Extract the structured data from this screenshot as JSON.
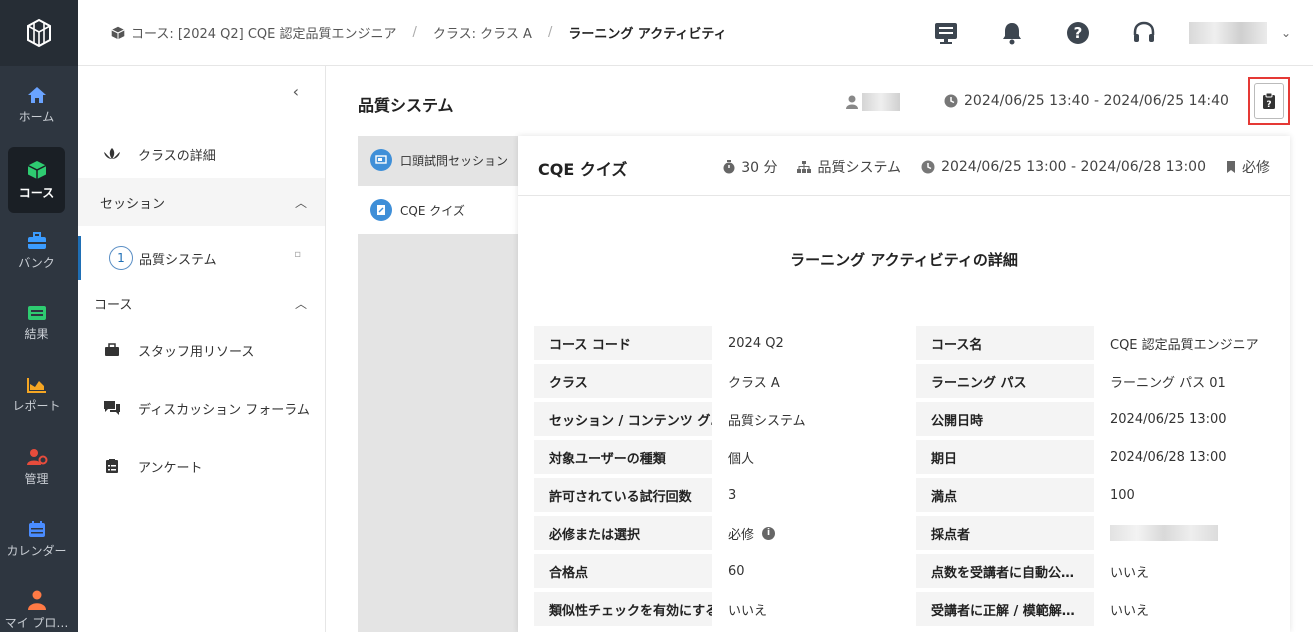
{
  "nav": {
    "items": [
      {
        "label": "ホーム"
      },
      {
        "label": "コース"
      },
      {
        "label": "バンク"
      },
      {
        "label": "結果"
      },
      {
        "label": "レポート"
      },
      {
        "label": "管理"
      },
      {
        "label": "カレンダー"
      },
      {
        "label": "マイ プロ…"
      }
    ],
    "colors": {
      "home": "#6aa3ff",
      "course": "#2ecc71",
      "bank": "#3b9cff",
      "results": "#2ecc71",
      "report": "#f5a623",
      "admin": "#e74c3c",
      "calendar": "#4a8cff",
      "profile": "#ff7a45"
    }
  },
  "breadcrumb": {
    "course": "コース: [2024 Q2] CQE 認定品質エンジニア",
    "class": "クラス: クラス A",
    "current": "ラーニング アクティビティ"
  },
  "side": {
    "class_detail": "クラスの詳細",
    "session_section": "セッション",
    "session_item_number": "1",
    "session_item": "品質システム",
    "course_section": "コース",
    "links": [
      "スタッフ用リソース",
      "ディスカッション フォーラム",
      "アンケート"
    ]
  },
  "main": {
    "title": "品質システム",
    "time_range": "2024/06/25 13:40 - 2024/06/25 14:40"
  },
  "activities": [
    {
      "label": "口頭試問セッション"
    },
    {
      "label": "CQE クイズ"
    }
  ],
  "card": {
    "title": "CQE クイズ",
    "duration": "30 分",
    "group": "品質システム",
    "period": "2024/06/25 13:00 - 2024/06/28 13:00",
    "required": "必修",
    "detail_title": "ラーニング アクティビティの詳細"
  },
  "details": {
    "left": [
      {
        "label": "コース コード",
        "value": "2024 Q2"
      },
      {
        "label": "クラス",
        "value": "クラス A"
      },
      {
        "label": "セッション / コンテンツ グ…",
        "value": "品質システム"
      },
      {
        "label": "対象ユーザーの種類",
        "value": "個人"
      },
      {
        "label": "許可されている試行回数",
        "value": "3"
      },
      {
        "label": "必修または選択",
        "value": "必修"
      },
      {
        "label": "合格点",
        "value": "60"
      },
      {
        "label": "類似性チェックを有効にする",
        "value": "いいえ"
      }
    ],
    "right": [
      {
        "label": "コース名",
        "value": "CQE 認定品質エンジニア"
      },
      {
        "label": "ラーニング パス",
        "value": "ラーニング パス 01"
      },
      {
        "label": "公開日時",
        "value": "2024/06/25 13:00"
      },
      {
        "label": "期日",
        "value": "2024/06/28 13:00"
      },
      {
        "label": "満点",
        "value": "100"
      },
      {
        "label": "採点者",
        "value": ""
      },
      {
        "label": "点数を受講者に自動公…",
        "value": "いいえ"
      },
      {
        "label": "受講者に正解 / 模範解…",
        "value": "いいえ"
      }
    ]
  }
}
